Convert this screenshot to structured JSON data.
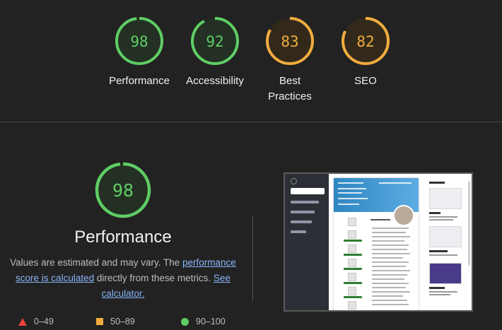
{
  "categories": [
    {
      "label": "Performance",
      "score": "98",
      "color": "#5fcd65"
    },
    {
      "label": "Accessibility",
      "score": "92",
      "color": "#5fcd65"
    },
    {
      "label": "Best Practices",
      "score": "83",
      "color": "#f0ac3d"
    },
    {
      "label": "SEO",
      "score": "82",
      "color": "#f0ac3d"
    }
  ],
  "main": {
    "score": "98",
    "title": "Performance",
    "desc_prefix": "Values are estimated and may vary. The ",
    "link1": "performance score is calculated",
    "desc_middle": " directly from these metrics. ",
    "link2": "See calculator."
  },
  "legend": {
    "fail": "0–49",
    "average": "50–89",
    "pass": "90–100"
  },
  "colors": {
    "pass": "#5fcd65",
    "average": "#f0ac3d",
    "fail": "#e9423b",
    "background": "#222222"
  }
}
